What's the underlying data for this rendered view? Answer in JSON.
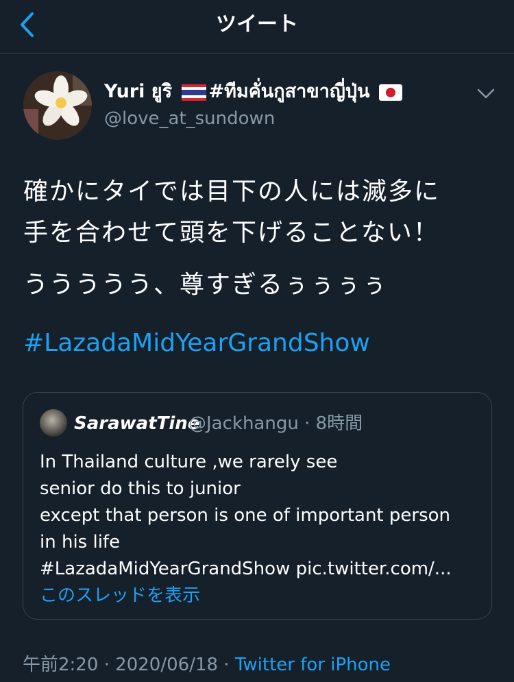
{
  "header": {
    "title": "ツイート",
    "accent": "#1da1f2"
  },
  "tweet": {
    "display_name_prefix": "Yuri ยูริ",
    "display_name_suffix": "#ทีมคั่นกูสาขาญี่ปุ่น",
    "handle": "@love_at_sundown",
    "text_line1": "確かにタイでは目下の人には滅多に",
    "text_line2": "手を合わせて頭を下げることない！",
    "text_line3": "ううううう、尊すぎるぅぅぅぅ",
    "hashtag": "#LazadaMidYearGrandShow"
  },
  "quote": {
    "name": "SarawatTine",
    "handle_time": "@Jackhangu · 8時間",
    "lines": [
      "In Thailand culture ,we rarely see",
      "senior do this to junior",
      "except that person is one of important person",
      "in his life",
      "#LazadaMidYearGrandShow pic.twitter.com/..."
    ],
    "show_thread": "このスレッドを表示"
  },
  "footer": {
    "time_date": "午前2:20 · 2020/06/18 · ",
    "source": "Twitter for iPhone"
  },
  "colors": {
    "background": "#15202b",
    "secondary_text": "#8899a6",
    "link": "#1da1f2",
    "border": "#38444d"
  }
}
